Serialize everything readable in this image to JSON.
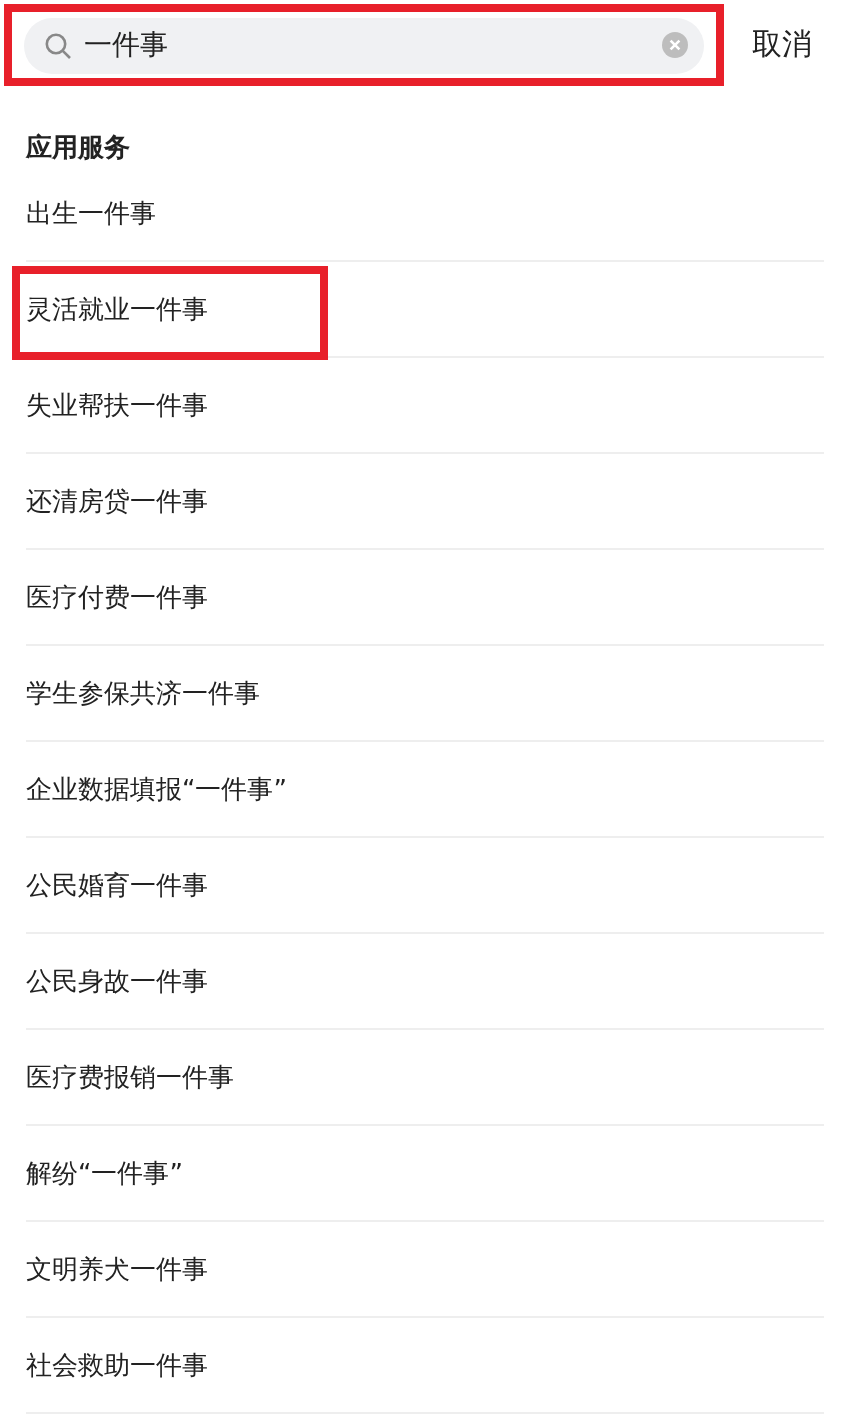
{
  "search": {
    "value": "一件事",
    "highlighted": true
  },
  "cancel": "取消",
  "section": {
    "title": "应用服务",
    "items": [
      {
        "label": "出生一件事",
        "highlighted": false
      },
      {
        "label": "灵活就业一件事",
        "highlighted": true
      },
      {
        "label": "失业帮扶一件事",
        "highlighted": false
      },
      {
        "label": "还清房贷一件事",
        "highlighted": false
      },
      {
        "label": "医疗付费一件事",
        "highlighted": false
      },
      {
        "label": "学生参保共济一件事",
        "highlighted": false
      },
      {
        "label": "企业数据填报“一件事”",
        "highlighted": false
      },
      {
        "label": "公民婚育一件事",
        "highlighted": false
      },
      {
        "label": "公民身故一件事",
        "highlighted": false
      },
      {
        "label": "医疗费报销一件事",
        "highlighted": false
      },
      {
        "label": "解纷“一件事”",
        "highlighted": false
      },
      {
        "label": "文明养犬一件事",
        "highlighted": false
      },
      {
        "label": "社会救助一件事",
        "highlighted": false
      }
    ]
  }
}
